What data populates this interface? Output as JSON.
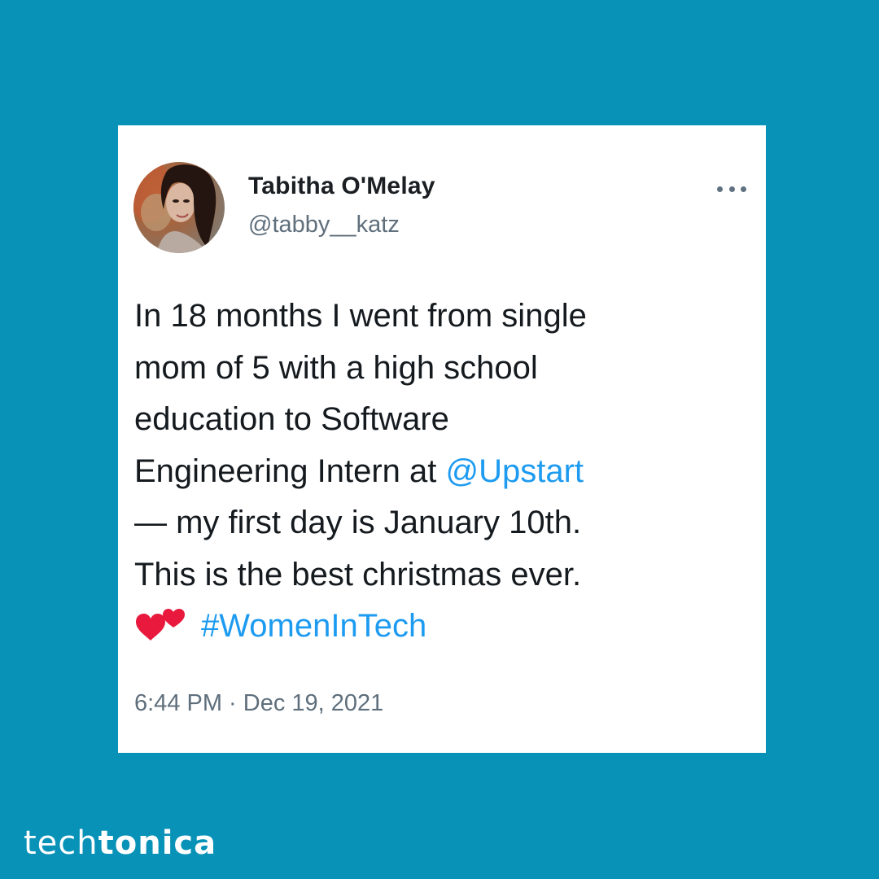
{
  "tweet": {
    "author": {
      "name": "Tabitha O'Melay",
      "handle": "@tabby__katz"
    },
    "text_lines": {
      "line1": "In 18 months I went from single",
      "line2": "mom of 5 with a high school",
      "line3": "education to Software",
      "line4_prefix": "Engineering Intern at ",
      "mention": "@Upstart",
      "line5": "— my first day is January 10th.",
      "line6": "This is the best christmas ever.",
      "hashtag": "#WomenInTech"
    },
    "timestamp": "6:44 PM · Dec 19, 2021",
    "more_icon": "more-horizontal-icon"
  },
  "brand": {
    "prefix": "tech",
    "suffix": "tonica"
  },
  "colors": {
    "background": "#0892b8",
    "card": "#ffffff",
    "link": "#1d9bf0",
    "text": "#151a1f",
    "muted": "#5f6f7c",
    "hearts": "#e8193d"
  }
}
